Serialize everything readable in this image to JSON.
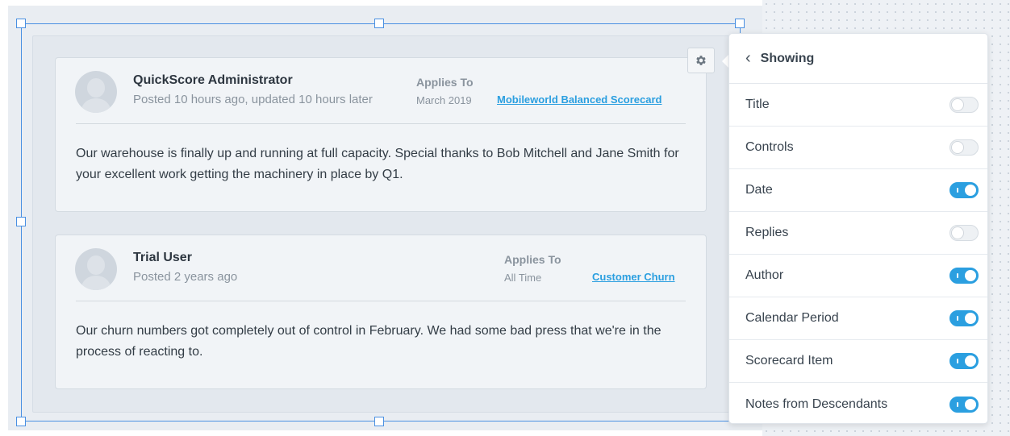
{
  "notes": [
    {
      "author": "QuickScore Administrator",
      "posted": "Posted 10 hours ago, updated 10 hours later",
      "applies_to_label": "Applies To",
      "period": "March 2019",
      "item": "Mobileworld Balanced Scorecard",
      "body": "Our warehouse is finally up and running at full capacity. Special thanks to Bob Mitchell and Jane Smith for your excellent work getting the machinery in place by Q1."
    },
    {
      "author": "Trial User",
      "posted": "Posted 2 years ago",
      "applies_to_label": "Applies To",
      "period": "All Time",
      "item": "Customer Churn",
      "body": "Our churn numbers got completely out of control in February. We had some bad press that we're in the process of reacting to."
    }
  ],
  "settings_panel": {
    "title": "Showing",
    "options": [
      {
        "label": "Title",
        "enabled": false
      },
      {
        "label": "Controls",
        "enabled": false
      },
      {
        "label": "Date",
        "enabled": true
      },
      {
        "label": "Replies",
        "enabled": false
      },
      {
        "label": "Author",
        "enabled": true
      },
      {
        "label": "Calendar Period",
        "enabled": true
      },
      {
        "label": "Scorecard Item",
        "enabled": true
      },
      {
        "label": "Notes from Descendants",
        "enabled": true
      }
    ]
  },
  "colors": {
    "accent": "#2b9fe0",
    "selection": "#4a90e2"
  },
  "icons": {
    "settings_button": "gear-icon",
    "back": "chevron-left-icon",
    "avatar": "user-avatar-icon"
  }
}
